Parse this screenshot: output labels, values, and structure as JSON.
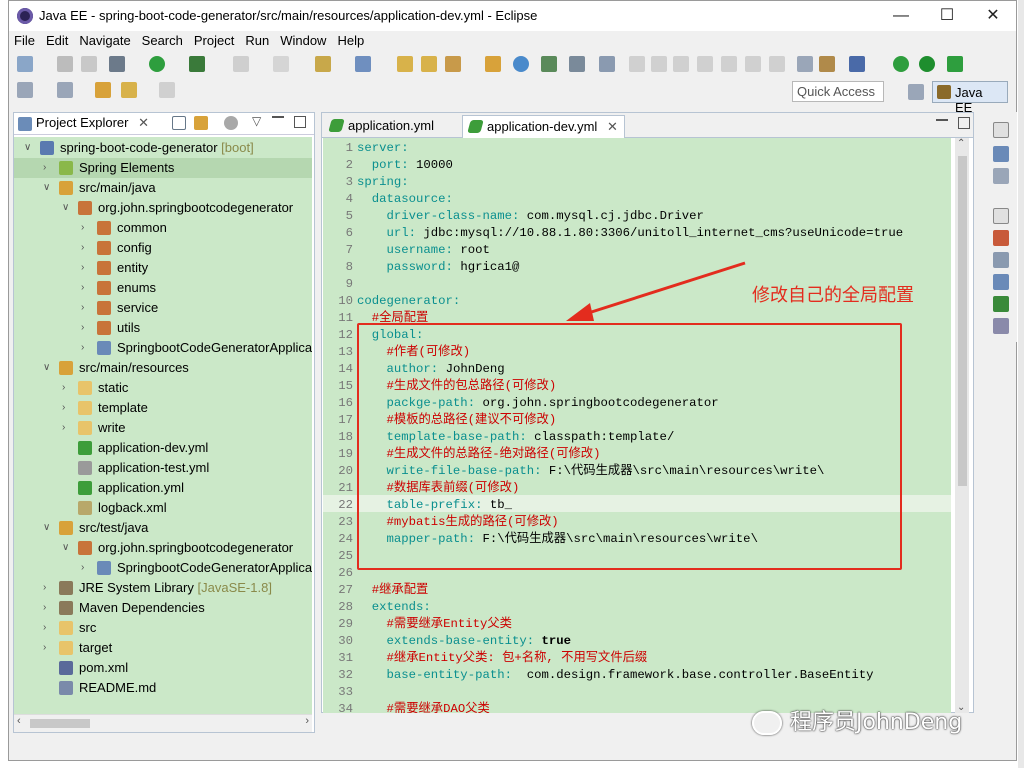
{
  "window": {
    "title": "Java EE - spring-boot-code-generator/src/main/resources/application-dev.yml - Eclipse"
  },
  "menu": [
    "File",
    "Edit",
    "Navigate",
    "Search",
    "Project",
    "Run",
    "Window",
    "Help"
  ],
  "toolbar": {
    "quick_access": "Quick Access",
    "perspective": "Java EE"
  },
  "project_explorer": {
    "title": "Project Explorer",
    "items": [
      {
        "label": "spring-boot-code-generator",
        "decoration": "[boot]"
      },
      {
        "label": "Spring Elements",
        "decoration": ""
      },
      {
        "label": "src/main/java",
        "decoration": ""
      },
      {
        "label": "org.john.springbootcodegenerator",
        "decoration": ""
      },
      {
        "label": "common",
        "decoration": ""
      },
      {
        "label": "config",
        "decoration": ""
      },
      {
        "label": "entity",
        "decoration": ""
      },
      {
        "label": "enums",
        "decoration": ""
      },
      {
        "label": "service",
        "decoration": ""
      },
      {
        "label": "utils",
        "decoration": ""
      },
      {
        "label": "SpringbootCodeGeneratorApplica",
        "decoration": ""
      },
      {
        "label": "src/main/resources",
        "decoration": ""
      },
      {
        "label": "static",
        "decoration": ""
      },
      {
        "label": "template",
        "decoration": ""
      },
      {
        "label": "write",
        "decoration": ""
      },
      {
        "label": "application-dev.yml",
        "decoration": ""
      },
      {
        "label": "application-test.yml",
        "decoration": ""
      },
      {
        "label": "application.yml",
        "decoration": ""
      },
      {
        "label": "logback.xml",
        "decoration": ""
      },
      {
        "label": "src/test/java",
        "decoration": ""
      },
      {
        "label": "org.john.springbootcodegenerator",
        "decoration": ""
      },
      {
        "label": "SpringbootCodeGeneratorApplica",
        "decoration": ""
      },
      {
        "label": "JRE System Library",
        "decoration": "[JavaSE-1.8]"
      },
      {
        "label": "Maven Dependencies",
        "decoration": ""
      },
      {
        "label": "src",
        "decoration": ""
      },
      {
        "label": "target",
        "decoration": ""
      },
      {
        "label": "pom.xml",
        "decoration": ""
      },
      {
        "label": "README.md",
        "decoration": ""
      }
    ]
  },
  "editor": {
    "tabs": [
      {
        "label": "application.yml"
      },
      {
        "label": "application-dev.yml"
      }
    ],
    "lines": [
      {
        "n": "1",
        "key": "server:",
        "val": "",
        "comment": ""
      },
      {
        "n": "2",
        "key": "  port:",
        "val": " 10000",
        "comment": ""
      },
      {
        "n": "3",
        "key": "spring:",
        "val": "",
        "comment": ""
      },
      {
        "n": "4",
        "key": "  datasource:",
        "val": "",
        "comment": ""
      },
      {
        "n": "5",
        "key": "    driver-class-name:",
        "val": " com.mysql.cj.jdbc.Driver",
        "comment": ""
      },
      {
        "n": "6",
        "key": "    url:",
        "val": " jdbc:mysql://10.88.1.80:3306/unitoll_internet_cms?useUnicode=true",
        "comment": ""
      },
      {
        "n": "7",
        "key": "    username:",
        "val": " root",
        "comment": ""
      },
      {
        "n": "8",
        "key": "    password:",
        "val": " hgrica1@",
        "comment": ""
      },
      {
        "n": "9",
        "key": "",
        "val": "",
        "comment": ""
      },
      {
        "n": "10",
        "key": "codegenerator:",
        "val": "",
        "comment": ""
      },
      {
        "n": "11",
        "key": "",
        "val": "",
        "comment": "  #全局配置"
      },
      {
        "n": "12",
        "key": "  global:",
        "val": "",
        "comment": ""
      },
      {
        "n": "13",
        "key": "",
        "val": "",
        "comment": "    #作者(可修改)"
      },
      {
        "n": "14",
        "key": "    author:",
        "val": " JohnDeng",
        "comment": ""
      },
      {
        "n": "15",
        "key": "",
        "val": "",
        "comment": "    #生成文件的包总路径(可修改)"
      },
      {
        "n": "16",
        "key": "    packge-path:",
        "val": " org.john.springbootcodegenerator",
        "comment": ""
      },
      {
        "n": "17",
        "key": "",
        "val": "",
        "comment": "    #模板的总路径(建议不可修改)"
      },
      {
        "n": "18",
        "key": "    template-base-path:",
        "val": " classpath:template/",
        "comment": ""
      },
      {
        "n": "19",
        "key": "",
        "val": "",
        "comment": "    #生成文件的总路径-绝对路径(可修改)"
      },
      {
        "n": "20",
        "key": "    write-file-base-path:",
        "val": " F:\\代码生成器\\src\\main\\resources\\write\\",
        "comment": ""
      },
      {
        "n": "21",
        "key": "",
        "val": "",
        "comment": "    #数据库表前缀(可修改)"
      },
      {
        "n": "22",
        "key": "    table-prefix:",
        "val": " tb_",
        "comment": ""
      },
      {
        "n": "23",
        "key": "",
        "val": "",
        "comment": "    #mybatis生成的路径(可修改)"
      },
      {
        "n": "24",
        "key": "    mapper-path:",
        "val": " F:\\代码生成器\\src\\main\\resources\\write\\",
        "comment": ""
      },
      {
        "n": "25",
        "key": "",
        "val": "",
        "comment": ""
      },
      {
        "n": "26",
        "key": "",
        "val": "",
        "comment": ""
      },
      {
        "n": "27",
        "key": "",
        "val": "",
        "comment": "  #继承配置"
      },
      {
        "n": "28",
        "key": "  extends:",
        "val": "",
        "comment": ""
      },
      {
        "n": "29",
        "key": "",
        "val": "",
        "comment": "    #需要继承Entity父类"
      },
      {
        "n": "30",
        "key": "    extends-base-entity:",
        "val": " true",
        "comment": ""
      },
      {
        "n": "31",
        "key": "",
        "val": "",
        "comment": "    #继承Entity父类: 包+名称, 不用写文件后缀"
      },
      {
        "n": "32",
        "key": "    base-entity-path:",
        "val": "  com.design.framework.base.controller.BaseEntity",
        "comment": ""
      },
      {
        "n": "33",
        "key": "",
        "val": "",
        "comment": ""
      },
      {
        "n": "34",
        "key": "",
        "val": "",
        "comment": "    #需要继承DAO父类"
      }
    ]
  },
  "annotation": "修改自己的全局配置",
  "watermark": "程序员JohnDeng",
  "colors": {
    "tree_bg": "#cbe8c8",
    "key": "#0a8f8f",
    "comment": "#cc0000",
    "highlight_box": "#e32c1e"
  }
}
